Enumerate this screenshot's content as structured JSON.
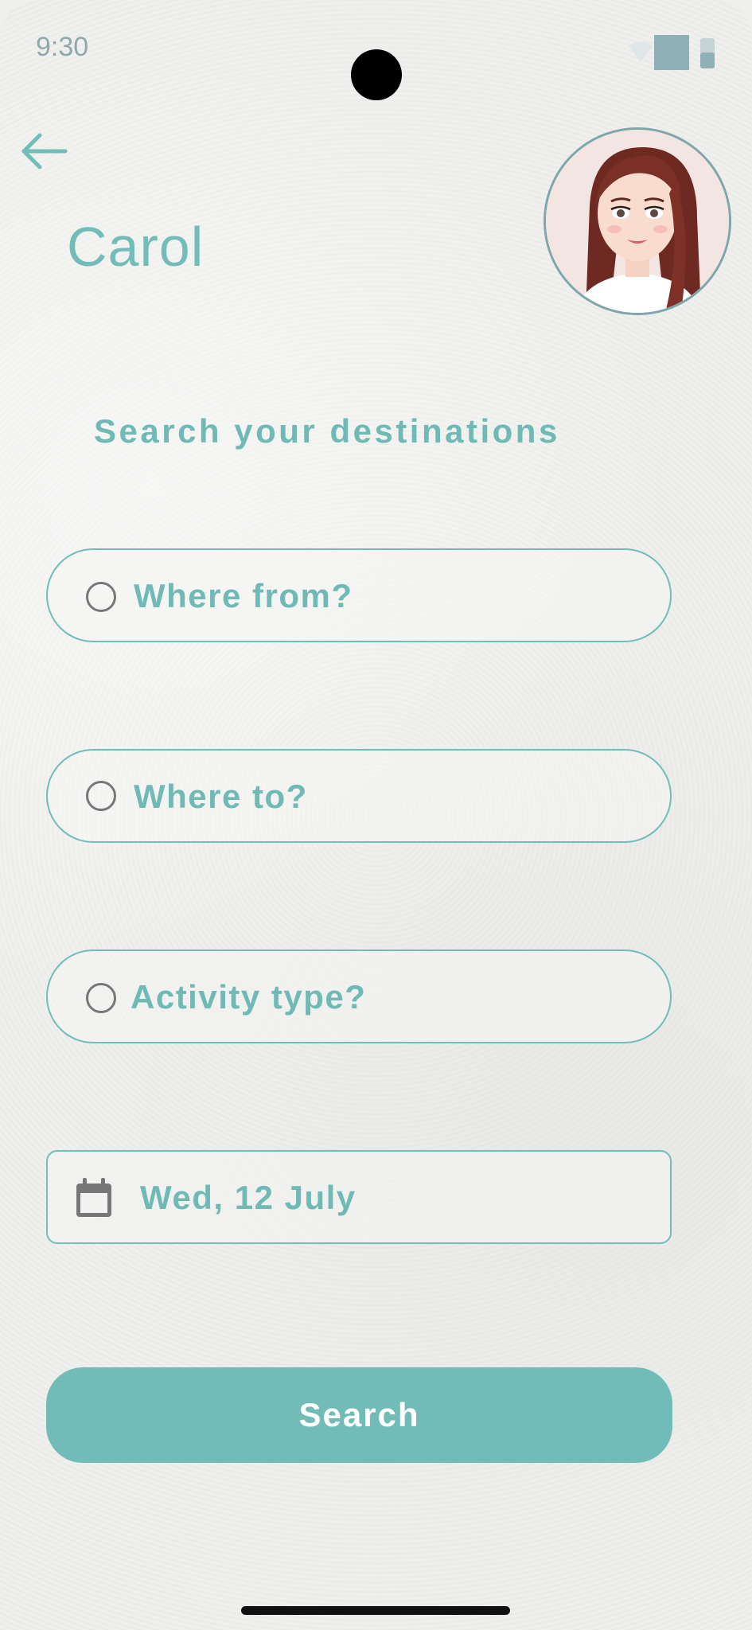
{
  "status_bar": {
    "time": "9:30"
  },
  "header": {
    "user_name": "Carol"
  },
  "search": {
    "heading": "Search your destinations",
    "where_from": "Where from?",
    "where_to": "Where to?",
    "activity_type": "Activity type?",
    "date": "Wed, 12 July",
    "button_label": "Search"
  },
  "icons": {
    "back": "arrow-left-icon",
    "radio": "radio-circle-icon",
    "calendar": "calendar-icon"
  },
  "colors": {
    "accent": "#72bdb8",
    "button_bg": "#71bcb6",
    "button_text": "#ffffff",
    "muted_status": "#8fa9ad"
  }
}
